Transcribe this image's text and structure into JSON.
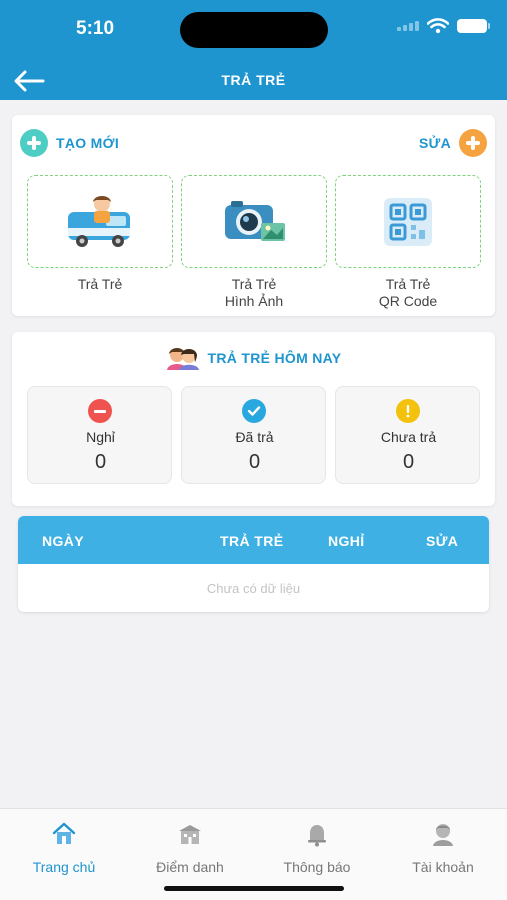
{
  "status_bar": {
    "time": "5:10"
  },
  "header": {
    "title": "TRẢ TRẺ",
    "back_icon": "arrow-left-icon"
  },
  "create_card": {
    "create_label": "TẠO MỚI",
    "edit_label": "SỬA",
    "create_color": "#4ecdc4",
    "edit_color": "#f4a340",
    "tiles": [
      {
        "line1": "Trả Trẻ",
        "line2": "",
        "icon": "bus-icon"
      },
      {
        "line1": "Trả Trẻ",
        "line2": "Hình Ảnh",
        "icon": "camera-icon"
      },
      {
        "line1": "Trả Trẻ",
        "line2": "QR Code",
        "icon": "qr-code-icon"
      }
    ]
  },
  "today_card": {
    "title": "TRẢ TRẺ HÔM NAY",
    "stats": [
      {
        "label": "Nghỉ",
        "value": "0",
        "color": "#ef5350",
        "icon": "minus-circle-icon"
      },
      {
        "label": "Đã trả",
        "value": "0",
        "color": "#29a8e0",
        "icon": "check-circle-icon"
      },
      {
        "label": "Chưa trả",
        "value": "0",
        "color": "#f4c20d",
        "icon": "exclamation-circle-icon"
      }
    ]
  },
  "table": {
    "columns": [
      "NGÀY",
      "TRẢ TRẺ",
      "NGHỈ",
      "SỬA"
    ],
    "empty_text": "Chưa có dữ liệu",
    "header_color": "#3fb0e4"
  },
  "tabbar": {
    "items": [
      {
        "label": "Trang chủ",
        "icon": "home-icon",
        "active": true
      },
      {
        "label": "Điểm danh",
        "icon": "school-icon",
        "active": false
      },
      {
        "label": "Thông báo",
        "icon": "bell-icon",
        "active": false
      },
      {
        "label": "Tài khoản",
        "icon": "user-icon",
        "active": false
      }
    ]
  }
}
